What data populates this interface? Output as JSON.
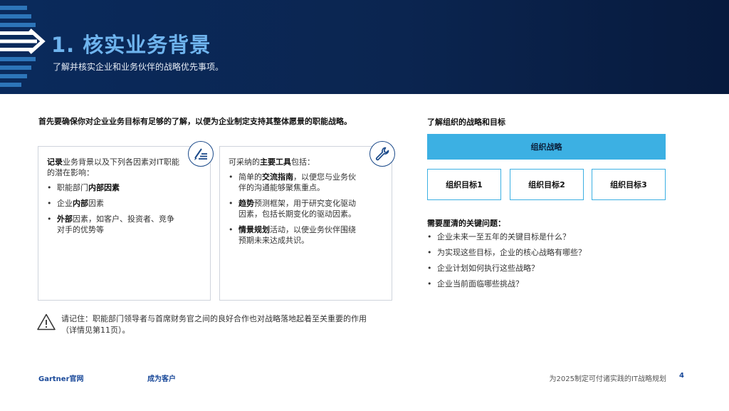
{
  "header": {
    "title": "1. 核实业务背景",
    "subtitle": "了解并核实企业和业务伙伴的战略优先事项。"
  },
  "intro": "首先要确保你对企业业务目标有足够的了解，以便为企业制定支持其整体愿景的职能战略。",
  "card1": {
    "lead_bold": "记录",
    "lead_rest": "业务背景以及下列各因素对IT职能的潜在影响：",
    "bullets": [
      {
        "pre": "职能部门",
        "bold": "内部因素",
        "post": ""
      },
      {
        "pre": "企业",
        "bold": "内部",
        "post": "因素"
      },
      {
        "pre": "",
        "bold": "外部",
        "post": "因素，如客户、投资者、竞争对手的优势等"
      }
    ]
  },
  "card2": {
    "lead_pre": "可采纳的",
    "lead_bold": "主要工具",
    "lead_post": "包括：",
    "bullets": [
      {
        "pre": "简单的",
        "bold": "交流指南",
        "post": "，以便您与业务伙伴的沟通能够聚焦重点。"
      },
      {
        "pre": "",
        "bold": "趋势",
        "post": "预测框架，用于研究变化驱动因素，包括长期变化的驱动因素。"
      },
      {
        "pre": "",
        "bold": "情景规划",
        "post": "活动，以使业务伙伴围绕预期未来达成共识。"
      }
    ]
  },
  "note": "请记住：职能部门领导者与首席财务官之间的良好合作也对战略落地起着至关重要的作用（详情见第11页）。",
  "right": {
    "title": "了解组织的战略和目标",
    "strategy": "组织战略",
    "goals": [
      "组织目标1",
      "组织目标2",
      "组织目标3"
    ],
    "questions_title": "需要厘清的关键问题：",
    "questions": [
      "企业未来一至五年的关键目标是什么？",
      "为实现这些目标，企业的核心战略有哪些？",
      "企业计划如何执行这些战略？",
      "企业当前面临哪些挑战？"
    ]
  },
  "footer": {
    "link1": "Gartner官网",
    "link2": "成为客户",
    "doc_title": "为2025制定可付诸实践的IT战略规划",
    "page": "4"
  },
  "icons": {
    "card1": "document-pen-icon",
    "card2": "wrench-icon",
    "note": "warning-icon"
  },
  "colors": {
    "header_bg": "#0a2a5c",
    "title": "#6fb4ee",
    "accent": "#3cb0e3",
    "link": "#1b4a9a"
  }
}
